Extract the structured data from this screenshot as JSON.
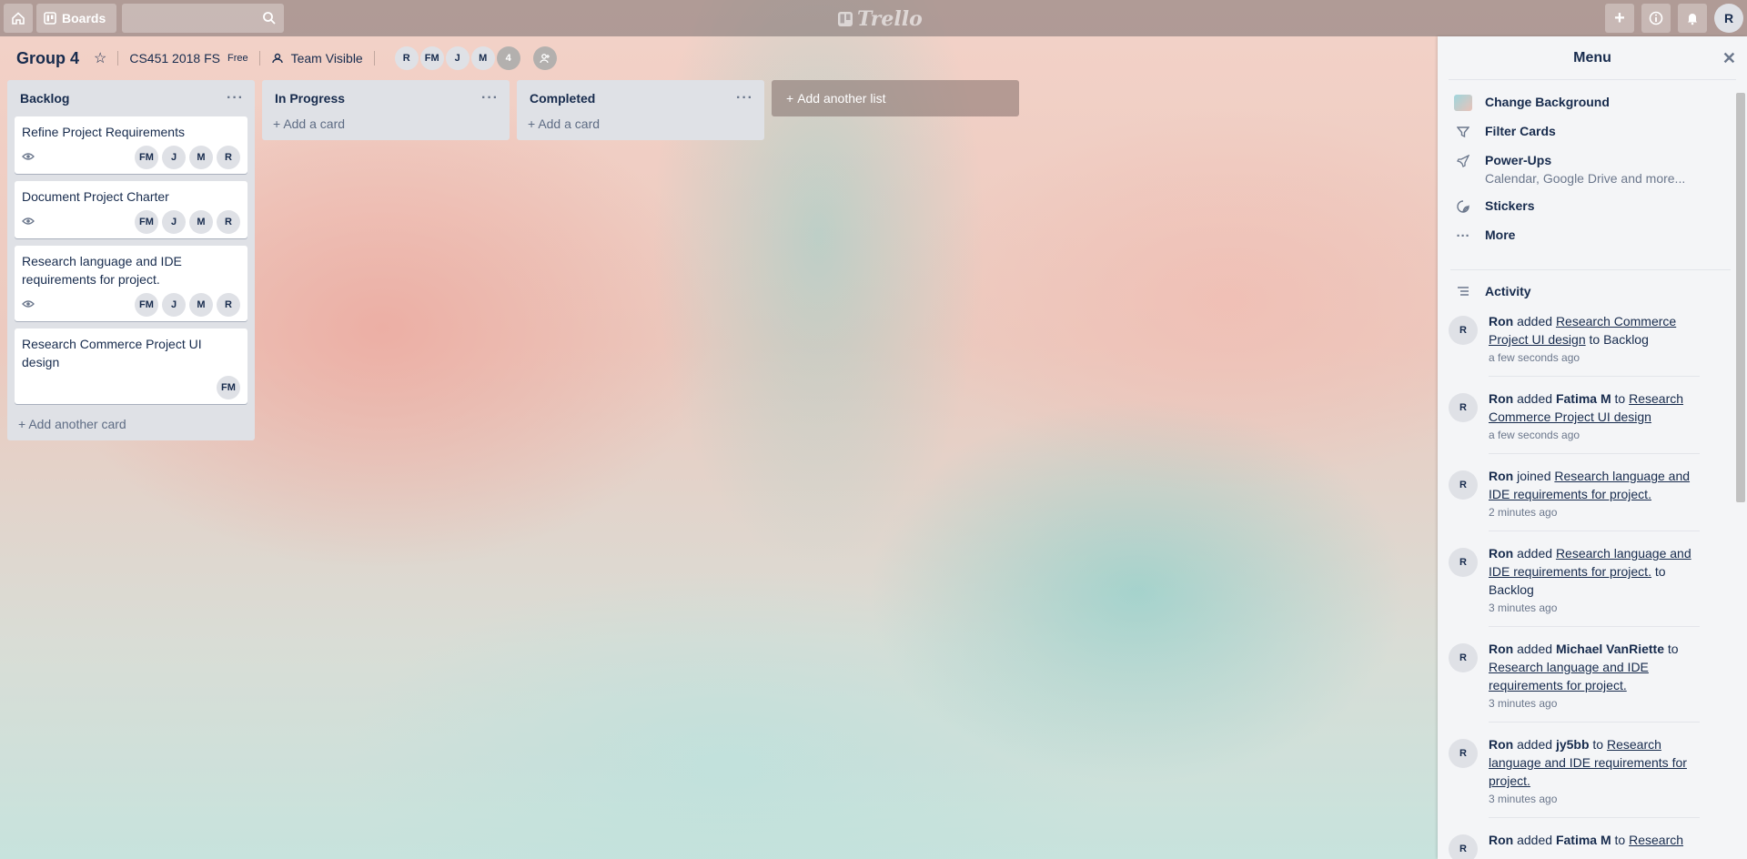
{
  "topbar": {
    "boards_label": "Boards",
    "search_placeholder": "",
    "logo_text": "Trello",
    "user_initial": "R"
  },
  "board": {
    "title": "Group 4",
    "team": "CS451 2018 FS",
    "plan": "Free",
    "visibility": "Team Visible",
    "members": [
      "R",
      "FM",
      "J",
      "M"
    ],
    "extra_count": "4"
  },
  "lists": [
    {
      "title": "Backlog",
      "cards": [
        {
          "title": "Refine Project Requirements",
          "watched": true,
          "members": [
            "FM",
            "J",
            "M",
            "R"
          ]
        },
        {
          "title": "Document Project Charter",
          "watched": true,
          "members": [
            "FM",
            "J",
            "M",
            "R"
          ]
        },
        {
          "title": "Research language and IDE requirements for project.",
          "watched": true,
          "members": [
            "FM",
            "J",
            "M",
            "R"
          ]
        },
        {
          "title": "Research Commerce Project UI design",
          "watched": false,
          "members": [
            "FM"
          ]
        }
      ],
      "add_label": "Add another card"
    },
    {
      "title": "In Progress",
      "cards": [],
      "add_label": "Add a card"
    },
    {
      "title": "Completed",
      "cards": [],
      "add_label": "Add a card"
    }
  ],
  "add_list_label": "Add another list",
  "menu": {
    "title": "Menu",
    "items": [
      {
        "icon": "background-swatch-icon",
        "label": "Change Background",
        "sub": ""
      },
      {
        "icon": "filter-icon",
        "label": "Filter Cards",
        "sub": ""
      },
      {
        "icon": "rocket-icon",
        "label": "Power-Ups",
        "sub": "Calendar, Google Drive and more..."
      },
      {
        "icon": "sticker-icon",
        "label": "Stickers",
        "sub": ""
      },
      {
        "icon": "more-dots-icon",
        "label": "More",
        "sub": ""
      }
    ],
    "activity_title": "Activity",
    "activity": [
      {
        "avatar": "R",
        "parts": [
          [
            "b",
            "Ron"
          ],
          [
            "t",
            " added "
          ],
          [
            "u",
            "Research Commerce Project UI design"
          ],
          [
            "t",
            " to Backlog"
          ]
        ],
        "time": "a few seconds ago"
      },
      {
        "avatar": "R",
        "parts": [
          [
            "b",
            "Ron"
          ],
          [
            "t",
            " added "
          ],
          [
            "b",
            "Fatima M"
          ],
          [
            "t",
            " to "
          ],
          [
            "u",
            "Research Commerce Project UI design"
          ]
        ],
        "time": "a few seconds ago"
      },
      {
        "avatar": "R",
        "parts": [
          [
            "b",
            "Ron"
          ],
          [
            "t",
            " joined "
          ],
          [
            "u",
            "Research language and IDE requirements for project."
          ]
        ],
        "time": "2 minutes ago"
      },
      {
        "avatar": "R",
        "parts": [
          [
            "b",
            "Ron"
          ],
          [
            "t",
            " added "
          ],
          [
            "u",
            "Research language and IDE requirements for project."
          ],
          [
            "t",
            " to Backlog"
          ]
        ],
        "time": "3 minutes ago"
      },
      {
        "avatar": "R",
        "parts": [
          [
            "b",
            "Ron"
          ],
          [
            "t",
            " added "
          ],
          [
            "b",
            "Michael VanRiette"
          ],
          [
            "t",
            " to "
          ],
          [
            "u",
            "Research language and IDE requirements for project."
          ]
        ],
        "time": "3 minutes ago"
      },
      {
        "avatar": "R",
        "parts": [
          [
            "b",
            "Ron"
          ],
          [
            "t",
            " added "
          ],
          [
            "b",
            "jy5bb"
          ],
          [
            "t",
            " to "
          ],
          [
            "u",
            "Research language and IDE requirements for project."
          ]
        ],
        "time": "3 minutes ago"
      },
      {
        "avatar": "R",
        "parts": [
          [
            "b",
            "Ron"
          ],
          [
            "t",
            " added "
          ],
          [
            "b",
            "Fatima M"
          ],
          [
            "t",
            " to "
          ],
          [
            "u",
            "Research"
          ]
        ],
        "time": ""
      }
    ]
  }
}
